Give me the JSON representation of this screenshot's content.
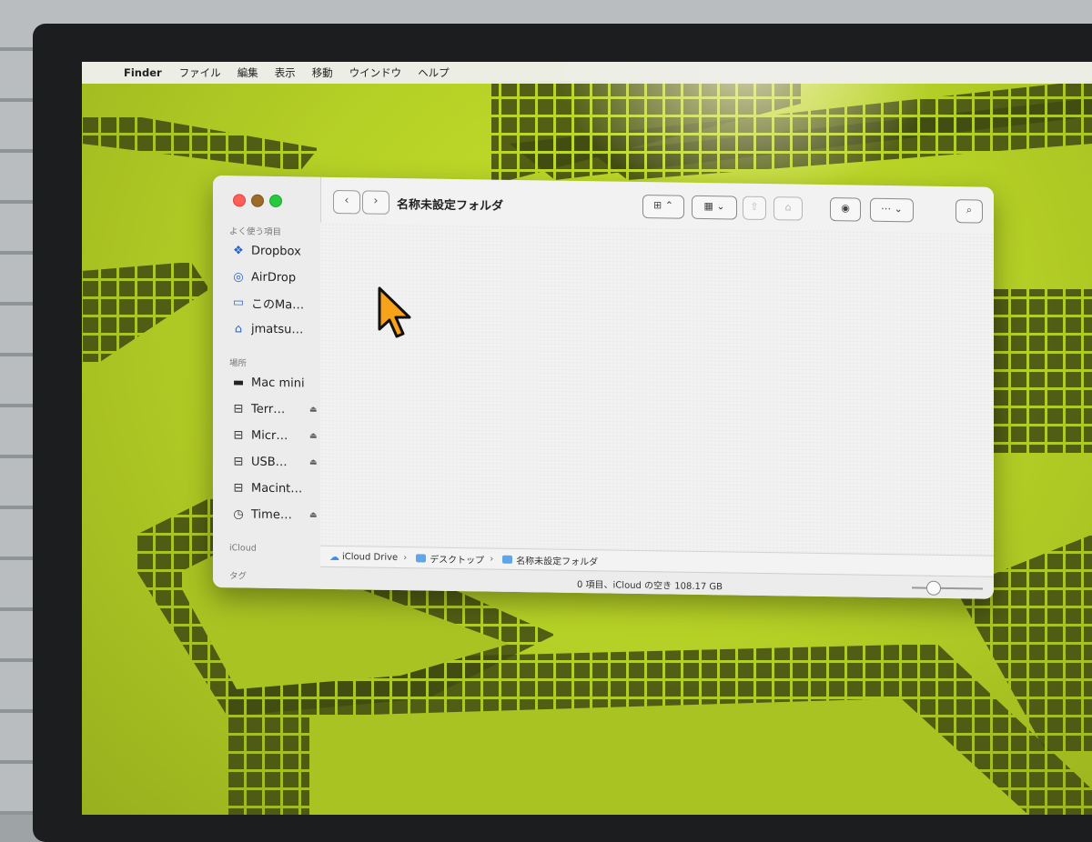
{
  "menubar": {
    "app": "Finder",
    "items": [
      "ファイル",
      "編集",
      "表示",
      "移動",
      "ウインドウ",
      "ヘルプ"
    ]
  },
  "window": {
    "title": "名称未設定フォルダ"
  },
  "sidebar": {
    "favorites_title": "よく使う項目",
    "favorites": [
      {
        "label": "Dropbox",
        "icon": "dropbox-icon"
      },
      {
        "label": "AirDrop",
        "icon": "airdrop-icon"
      },
      {
        "label": "このMa…",
        "icon": "folder-icon"
      },
      {
        "label": "jmatsuda",
        "icon": "home-icon"
      }
    ],
    "locations_title": "場所",
    "locations": [
      {
        "label": "Mac mini",
        "icon": "mac-mini-icon",
        "eject": false
      },
      {
        "label": "Terr…",
        "icon": "drive-icon",
        "eject": true
      },
      {
        "label": "Micr…",
        "icon": "drive-icon",
        "eject": true
      },
      {
        "label": "USB…",
        "icon": "drive-icon",
        "eject": true
      },
      {
        "label": "Macint…",
        "icon": "drive-icon",
        "eject": false
      },
      {
        "label": "Time…",
        "icon": "time-machine-icon",
        "eject": true
      }
    ],
    "icloud_title": "iCloud",
    "tags_title": "タグ"
  },
  "pathbar": {
    "crumbs": [
      "iCloud Drive",
      "デスクトップ",
      "名称未設定フォルダ"
    ]
  },
  "status": {
    "text": "0 項目、iCloud の空き 108.17 GB"
  },
  "zoom": {
    "level": 0.25
  }
}
